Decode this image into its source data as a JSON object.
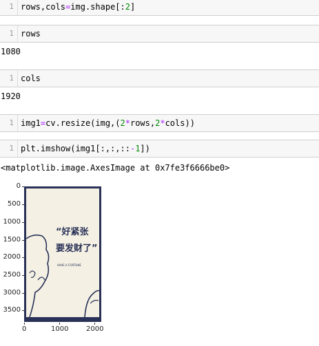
{
  "cells": [
    {
      "line": "1",
      "code": "rows,cols=img.shape[:2]"
    },
    {
      "line": "1",
      "code": "rows"
    },
    {
      "line": "1",
      "code": "cols"
    },
    {
      "line": "1",
      "code": "img1=cv.resize(img,(2*rows,2*cols))"
    },
    {
      "line": "1",
      "code": "plt.imshow(img1[:,:,::-1])"
    }
  ],
  "outputs": {
    "rows_out": "1080",
    "cols_out": "1920",
    "imshow_out": "<matplotlib.image.AxesImage at 0x7fe3f6666be0>"
  },
  "poster": {
    "title_line1": "“好紧张",
    "title_line2": "要发财了”",
    "subtitle": "HAVE A FORTUNE"
  },
  "chart_data": {
    "type": "image",
    "yticks": [
      "0",
      "500",
      "1000",
      "1500",
      "2000",
      "2500",
      "3000",
      "3500"
    ],
    "xticks": [
      "0",
      "1000",
      "2000"
    ],
    "ylim": [
      3840,
      0
    ],
    "xlim": [
      0,
      2160
    ]
  },
  "colors": {
    "cell_bg": "#f7f7f7",
    "poster_bg": "#f4f1e4",
    "poster_ink": "#2a3157",
    "poster_border": "#2a3157",
    "keyword": "#aa22ff",
    "number": "#008800"
  }
}
